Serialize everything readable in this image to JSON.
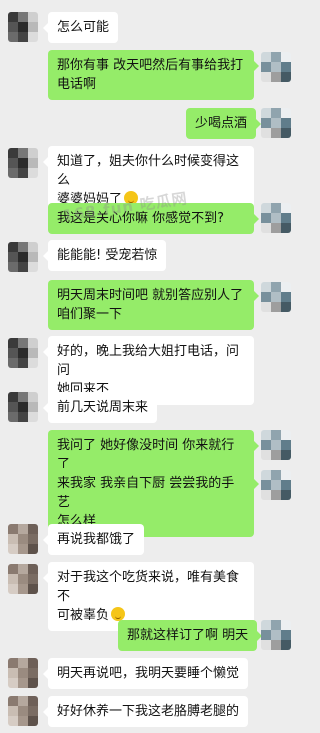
{
  "watermark": "168.fun 吃瓜网",
  "messages": [
    {
      "side": "in",
      "text": "怎么可能"
    },
    {
      "side": "out",
      "text": "那你有事 改天吧然后有事给我打\n电话啊"
    },
    {
      "side": "out",
      "text": "少喝点酒"
    },
    {
      "side": "in",
      "text": "知道了，姐夫你什么时候变得这么\n婆婆妈妈了",
      "emoji": "smile-emoji"
    },
    {
      "side": "out",
      "text": "我这是关心你嘛 你感觉不到?"
    },
    {
      "side": "in",
      "text": "能能能! 受宠若惊"
    },
    {
      "side": "out",
      "text": "明天周末时间吧 就别答应别人了\n咱们聚一下"
    },
    {
      "side": "in",
      "text": "好的，晚上我给大姐打电话，问问\n她回来不"
    },
    {
      "side": "in",
      "text": "前几天说周末来"
    },
    {
      "side": "out",
      "text": "我问了 她好像没时间 你来就行了"
    },
    {
      "side": "out",
      "text": "来我家 我亲自下厨 尝尝我的手艺\n怎么样"
    },
    {
      "side": "in",
      "text": "再说我都饿了"
    },
    {
      "side": "in",
      "text": "对于我这个吃货来说，唯有美食不\n可被辜负",
      "emoji": "tongue-emoji"
    },
    {
      "side": "out",
      "text": "那就这样订了啊 明天"
    },
    {
      "side": "in",
      "text": "明天再说吧，我明天要睡个懒觉"
    },
    {
      "side": "in",
      "text": "好好休养一下我这老胳膊老腿的"
    }
  ],
  "colors": {
    "background": "#ededed",
    "incoming_bubble": "#ffffff",
    "outgoing_bubble": "#95ec69"
  }
}
